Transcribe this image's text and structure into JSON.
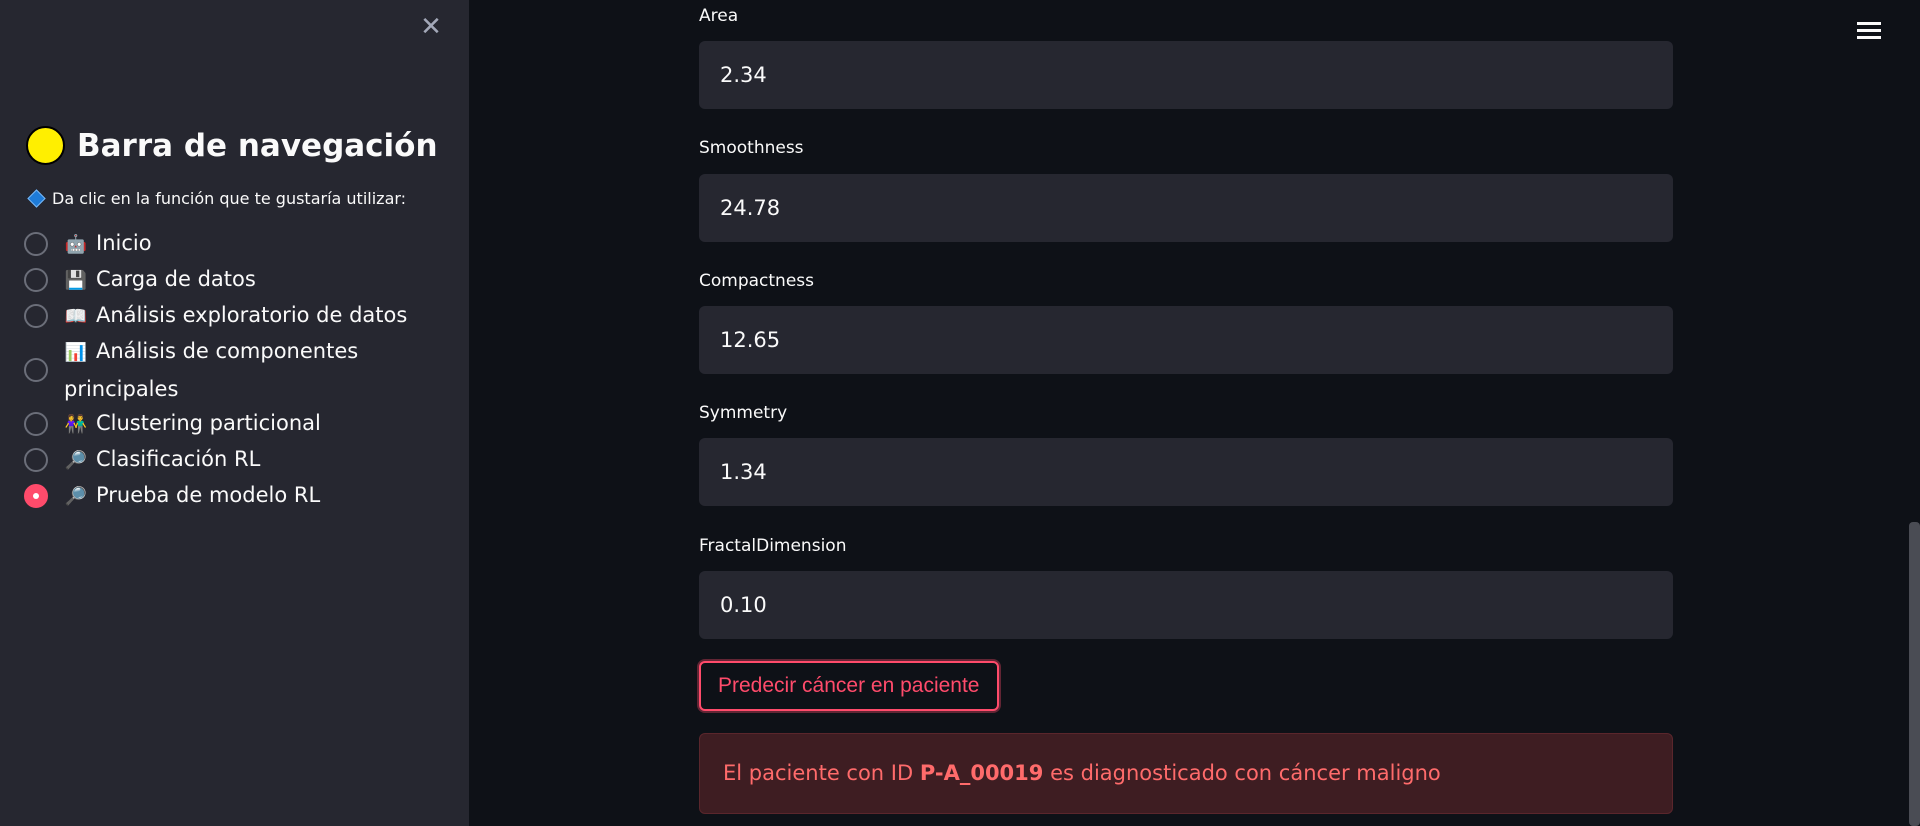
{
  "sidebar": {
    "title": "Barra de navegación",
    "instruction": "Da clic en la función que te gustaría utilizar:",
    "items": [
      {
        "emoji": "🤖",
        "label": "Inicio",
        "selected": false
      },
      {
        "emoji": "💾",
        "label": "Carga de datos",
        "selected": false
      },
      {
        "emoji": "📖",
        "label": "Análisis exploratorio de datos",
        "selected": false
      },
      {
        "emoji": "📊",
        "label": "Análisis de componentes principales",
        "selected": false
      },
      {
        "emoji": "👫",
        "label": "Clustering particional",
        "selected": false
      },
      {
        "emoji": "🔎",
        "label": "Clasificación RL",
        "selected": false
      },
      {
        "emoji": "🔎",
        "label": "Prueba de modelo RL",
        "selected": true
      }
    ]
  },
  "fields": [
    {
      "label": "Area",
      "value": "2.34"
    },
    {
      "label": "Smoothness",
      "value": "24.78"
    },
    {
      "label": "Compactness",
      "value": "12.65"
    },
    {
      "label": "Symmetry",
      "value": "1.34"
    },
    {
      "label": "FractalDimension",
      "value": "0.10"
    }
  ],
  "predict_button": "Predecir cáncer en paciente",
  "result": {
    "prefix": "El paciente con ID ",
    "patient_id": "P-A_00019",
    "suffix": " es diagnosticado con cáncer maligno"
  },
  "colors": {
    "accent": "#ff4b6b",
    "background": "#0e1117",
    "sidebar": "#262730",
    "error_text": "#ff6b6b"
  }
}
